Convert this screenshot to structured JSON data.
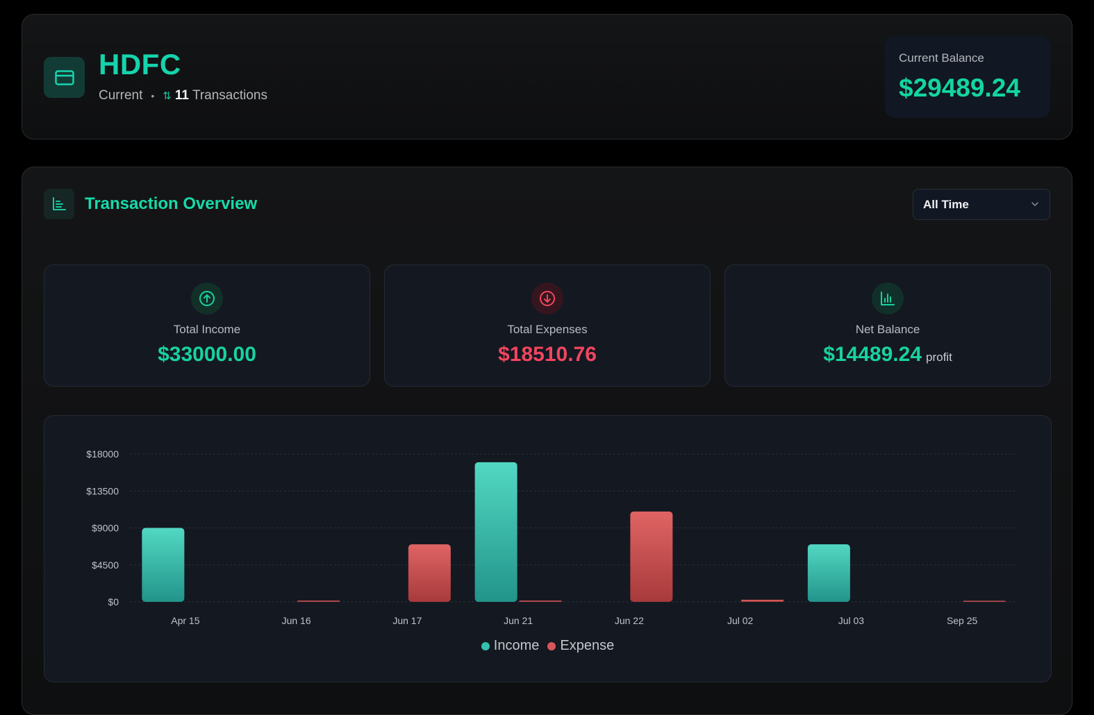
{
  "account": {
    "name": "HDFC",
    "type": "Current",
    "transaction_count": "11",
    "transactions_label": "Transactions",
    "balance_label": "Current Balance",
    "balance_value": "$29489.24"
  },
  "overview": {
    "title": "Transaction Overview",
    "filter": "All Time"
  },
  "stats": {
    "income": {
      "label": "Total Income",
      "value": "$33000.00",
      "color": "#18d29f"
    },
    "expenses": {
      "label": "Total Expenses",
      "value": "$18510.76",
      "color": "#f2455f"
    },
    "net": {
      "label": "Net Balance",
      "value": "$14489.24",
      "suffix": "profit",
      "color": "#18d29f"
    }
  },
  "colors": {
    "accent": "#15d4ac",
    "income_top": "#52d8c2",
    "income_bottom": "#22948a",
    "expense_top": "#e06464",
    "expense_bottom": "#a83a3c"
  },
  "chart_data": {
    "type": "bar",
    "categories": [
      "Apr 15",
      "Jun 16",
      "Jun 17",
      "Jun 21",
      "Jun 22",
      "Jul 02",
      "Jul 03",
      "Sep 25"
    ],
    "series": [
      {
        "name": "Income",
        "values": [
          9000,
          0,
          0,
          17000,
          0,
          0,
          7000,
          0
        ]
      },
      {
        "name": "Expense",
        "values": [
          0,
          150,
          7000,
          150,
          11000,
          250,
          0,
          100
        ]
      }
    ],
    "yticks": [
      "$0",
      "$4500",
      "$9000",
      "$13500",
      "$18000"
    ],
    "ylim": [
      0,
      18000
    ],
    "grid": true,
    "legend": "bottom"
  }
}
